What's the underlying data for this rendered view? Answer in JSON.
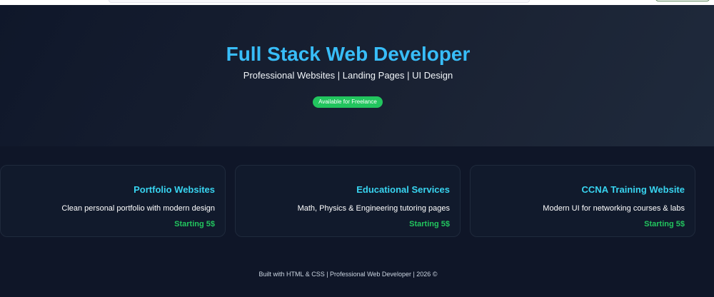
{
  "hero": {
    "title": "Full Stack Web Developer",
    "subtitle": "Professional Websites | Landing Pages | UI Design",
    "badge": "Available for Freelance"
  },
  "services": [
    {
      "title": "Portfolio Websites",
      "description": "Clean personal portfolio with modern design",
      "price": "Starting 5$"
    },
    {
      "title": "Educational Services",
      "description": "Math, Physics & Engineering tutoring pages",
      "price": "Starting 5$"
    },
    {
      "title": "CCNA Training Website",
      "description": "Modern UI for networking courses & labs",
      "price": "Starting 5$"
    }
  ],
  "footer": {
    "text": "Built with HTML & CSS | Professional Web Developer | 2026 ©"
  }
}
